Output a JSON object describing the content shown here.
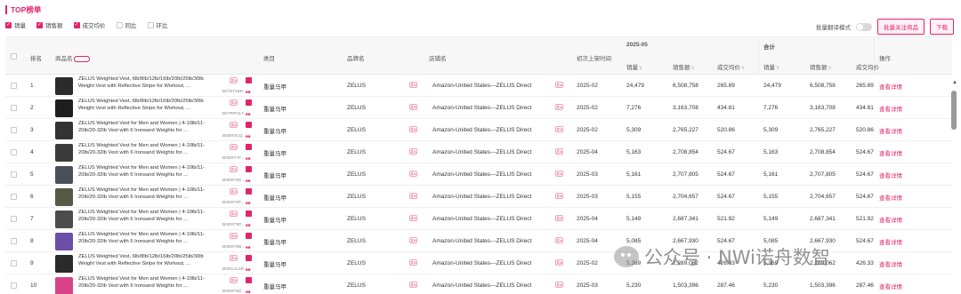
{
  "title": "TOP榜单",
  "filters": [
    {
      "label": "销量",
      "checked": true
    },
    {
      "label": "销售额",
      "checked": true
    },
    {
      "label": "成交均价",
      "checked": true
    },
    {
      "label": "同比",
      "checked": false
    },
    {
      "label": "环比",
      "checked": false
    }
  ],
  "toolbar": {
    "toggle_label": "批量翻译模式",
    "follow_button": "批量关注商品",
    "download_button": "下载"
  },
  "header": {
    "rank": "排名",
    "product_name": "商品名",
    "category": "类目",
    "brand": "品牌名",
    "shop": "店铺名",
    "first_listed": "初次上架时间",
    "period": "2025-05",
    "total": "合计",
    "sales": "销量",
    "revenue": "销售额",
    "avg_price": "成交均价",
    "action": "操作"
  },
  "rows": [
    {
      "rank": "1",
      "name": "ZELUS Weighted Vest, 6lb/8lb/12lb/16lb/20lb/25lb/30lb Weight Vest with Reflective Stripe for Workout, ...",
      "asin": "B075T18R...",
      "category": "重量马甲",
      "brand": "ZELUS",
      "shop": "Amazon-United States---ZELUS Direct",
      "listed": "2025-02",
      "sales": "24,479",
      "revenue": "6,508,758",
      "avg": "265.89",
      "t_sales": "24,479",
      "t_revenue": "6,508,758",
      "t_avg": "265.89",
      "action": "查看详情",
      "img": "#2b2b2b"
    },
    {
      "rank": "2",
      "name": "ZELUS Weighted Vest, 6lb/8lb/12lb/16lb/20lb/25lb/30lb Weight Vest with Reflective Stripe for Workout, ...",
      "asin": "B07RPGLT...",
      "category": "重量马甲",
      "brand": "ZELUS",
      "shop": "Amazon-United States---ZELUS Direct",
      "listed": "2025-02",
      "sales": "7,276",
      "revenue": "3,163,708",
      "avg": "434.81",
      "t_sales": "7,276",
      "t_revenue": "3,163,708",
      "t_avg": "434.81",
      "action": "查看详情",
      "img": "#1e1e1e"
    },
    {
      "rank": "3",
      "name": "ZELUS Weighted Vest for Men and Women | 4-10lb/11-20lb/20-32lb Vest with 6 Ironsand Weights for ...",
      "asin": "B0BR4CQ...",
      "category": "重量马甲",
      "brand": "ZELUS",
      "shop": "Amazon-United States---ZELUS Direct",
      "listed": "2025-02",
      "sales": "5,309",
      "revenue": "2,765,227",
      "avg": "520.86",
      "t_sales": "5,309",
      "t_revenue": "2,765,227",
      "t_avg": "520.86",
      "action": "查看详情",
      "img": "#333333"
    },
    {
      "rank": "4",
      "name": "ZELUS Weighted Vest for Men and Women | 4-10lb/11-20lb/20-32lb Vest with 6 Ironsand Weights for ...",
      "asin": "B0DR77F...",
      "category": "重量马甲",
      "brand": "ZELUS",
      "shop": "Amazon-United States---ZELUS Direct",
      "listed": "2025-04",
      "sales": "5,163",
      "revenue": "2,708,854",
      "avg": "524.67",
      "t_sales": "5,163",
      "t_revenue": "2,708,854",
      "t_avg": "524.67",
      "action": "查看详情",
      "img": "#3a3a3a"
    },
    {
      "rank": "5",
      "name": "ZELUS Weighted Vest for Men and Women | 4-10lb/11-20lb/20-32lb Vest with 6 Ironsand Weights for ...",
      "asin": "B0DR78S...",
      "category": "重量马甲",
      "brand": "ZELUS",
      "shop": "Amazon-United States---ZELUS Direct",
      "listed": "2025-03",
      "sales": "5,161",
      "revenue": "2,707,805",
      "avg": "524.67",
      "t_sales": "5,161",
      "t_revenue": "2,707,805",
      "t_avg": "524.67",
      "action": "查看详情",
      "img": "#4a4f5a"
    },
    {
      "rank": "6",
      "name": "ZELUS Weighted Vest for Men and Women | 4-10lb/11-20lb/20-32lb Vest with 6 Ironsand Weights for ...",
      "asin": "B0DR78T...",
      "category": "重量马甲",
      "brand": "ZELUS",
      "shop": "Amazon-United States---ZELUS Direct",
      "listed": "2025-03",
      "sales": "5,155",
      "revenue": "2,704,657",
      "avg": "524.67",
      "t_sales": "5,155",
      "t_revenue": "2,704,657",
      "t_avg": "524.67",
      "action": "查看详情",
      "img": "#555a45"
    },
    {
      "rank": "7",
      "name": "ZELUS Weighted Vest for Men and Women | 4-10lb/11-20lb/20-32lb Vest with 6 Ironsand Weights for ...",
      "asin": "B0DR79P...",
      "category": "重量马甲",
      "brand": "ZELUS",
      "shop": "Amazon-United States---ZELUS Direct",
      "listed": "2025-04",
      "sales": "5,149",
      "revenue": "2,687,341",
      "avg": "521.92",
      "t_sales": "5,149",
      "t_revenue": "2,687,341",
      "t_avg": "521.92",
      "action": "查看详情",
      "img": "#4c4c4c"
    },
    {
      "rank": "8",
      "name": "ZELUS Weighted Vest for Men and Women | 4-10lb/11-20lb/20-32lb Vest with 6 Ironsand Weights for ...",
      "asin": "B0DR79B...",
      "category": "重量马甲",
      "brand": "ZELUS",
      "shop": "Amazon-United States---ZELUS Direct",
      "listed": "2025-04",
      "sales": "5,085",
      "revenue": "2,667,930",
      "avg": "524.67",
      "t_sales": "5,085",
      "t_revenue": "2,667,930",
      "t_avg": "524.67",
      "action": "查看详情",
      "img": "#6b4fa8"
    },
    {
      "rank": "9",
      "name": "ZELUS Weighted Vest, 6lb/8lb/12lb/16lb/20lb/25lb/30lb Weight Vest with Reflective Stripe for Workout, ...",
      "asin": "B081ULSR...",
      "category": "重量马甲",
      "brand": "ZELUS",
      "shop": "Amazon-United States---ZELUS Direct",
      "listed": "2025-02",
      "sales": "5,369",
      "revenue": "2,289,062",
      "avg": "426.33",
      "t_sales": "5,369",
      "t_revenue": "2,289,062",
      "t_avg": "426.33",
      "action": "查看详情",
      "img": "#2a2a2a"
    },
    {
      "rank": "10",
      "name": "ZELUS Weighted Vest for Men and Women | 4-10lb/11-20lb/20-32lb Vest with 6 Ironsand Weights for ...",
      "asin": "B0DR78Z...",
      "category": "重量马甲",
      "brand": "ZELUS",
      "shop": "Amazon-United States---ZELUS Direct",
      "listed": "2025-03",
      "sales": "5,230",
      "revenue": "1,503,396",
      "avg": "287.46",
      "t_sales": "5,230",
      "t_revenue": "1,503,396",
      "t_avg": "287.46",
      "action": "查看详情",
      "img": "#d9438a"
    }
  ],
  "watermark": "公众号 · NWi诺舟数智",
  "colors": {
    "accent": "#e3246a"
  }
}
